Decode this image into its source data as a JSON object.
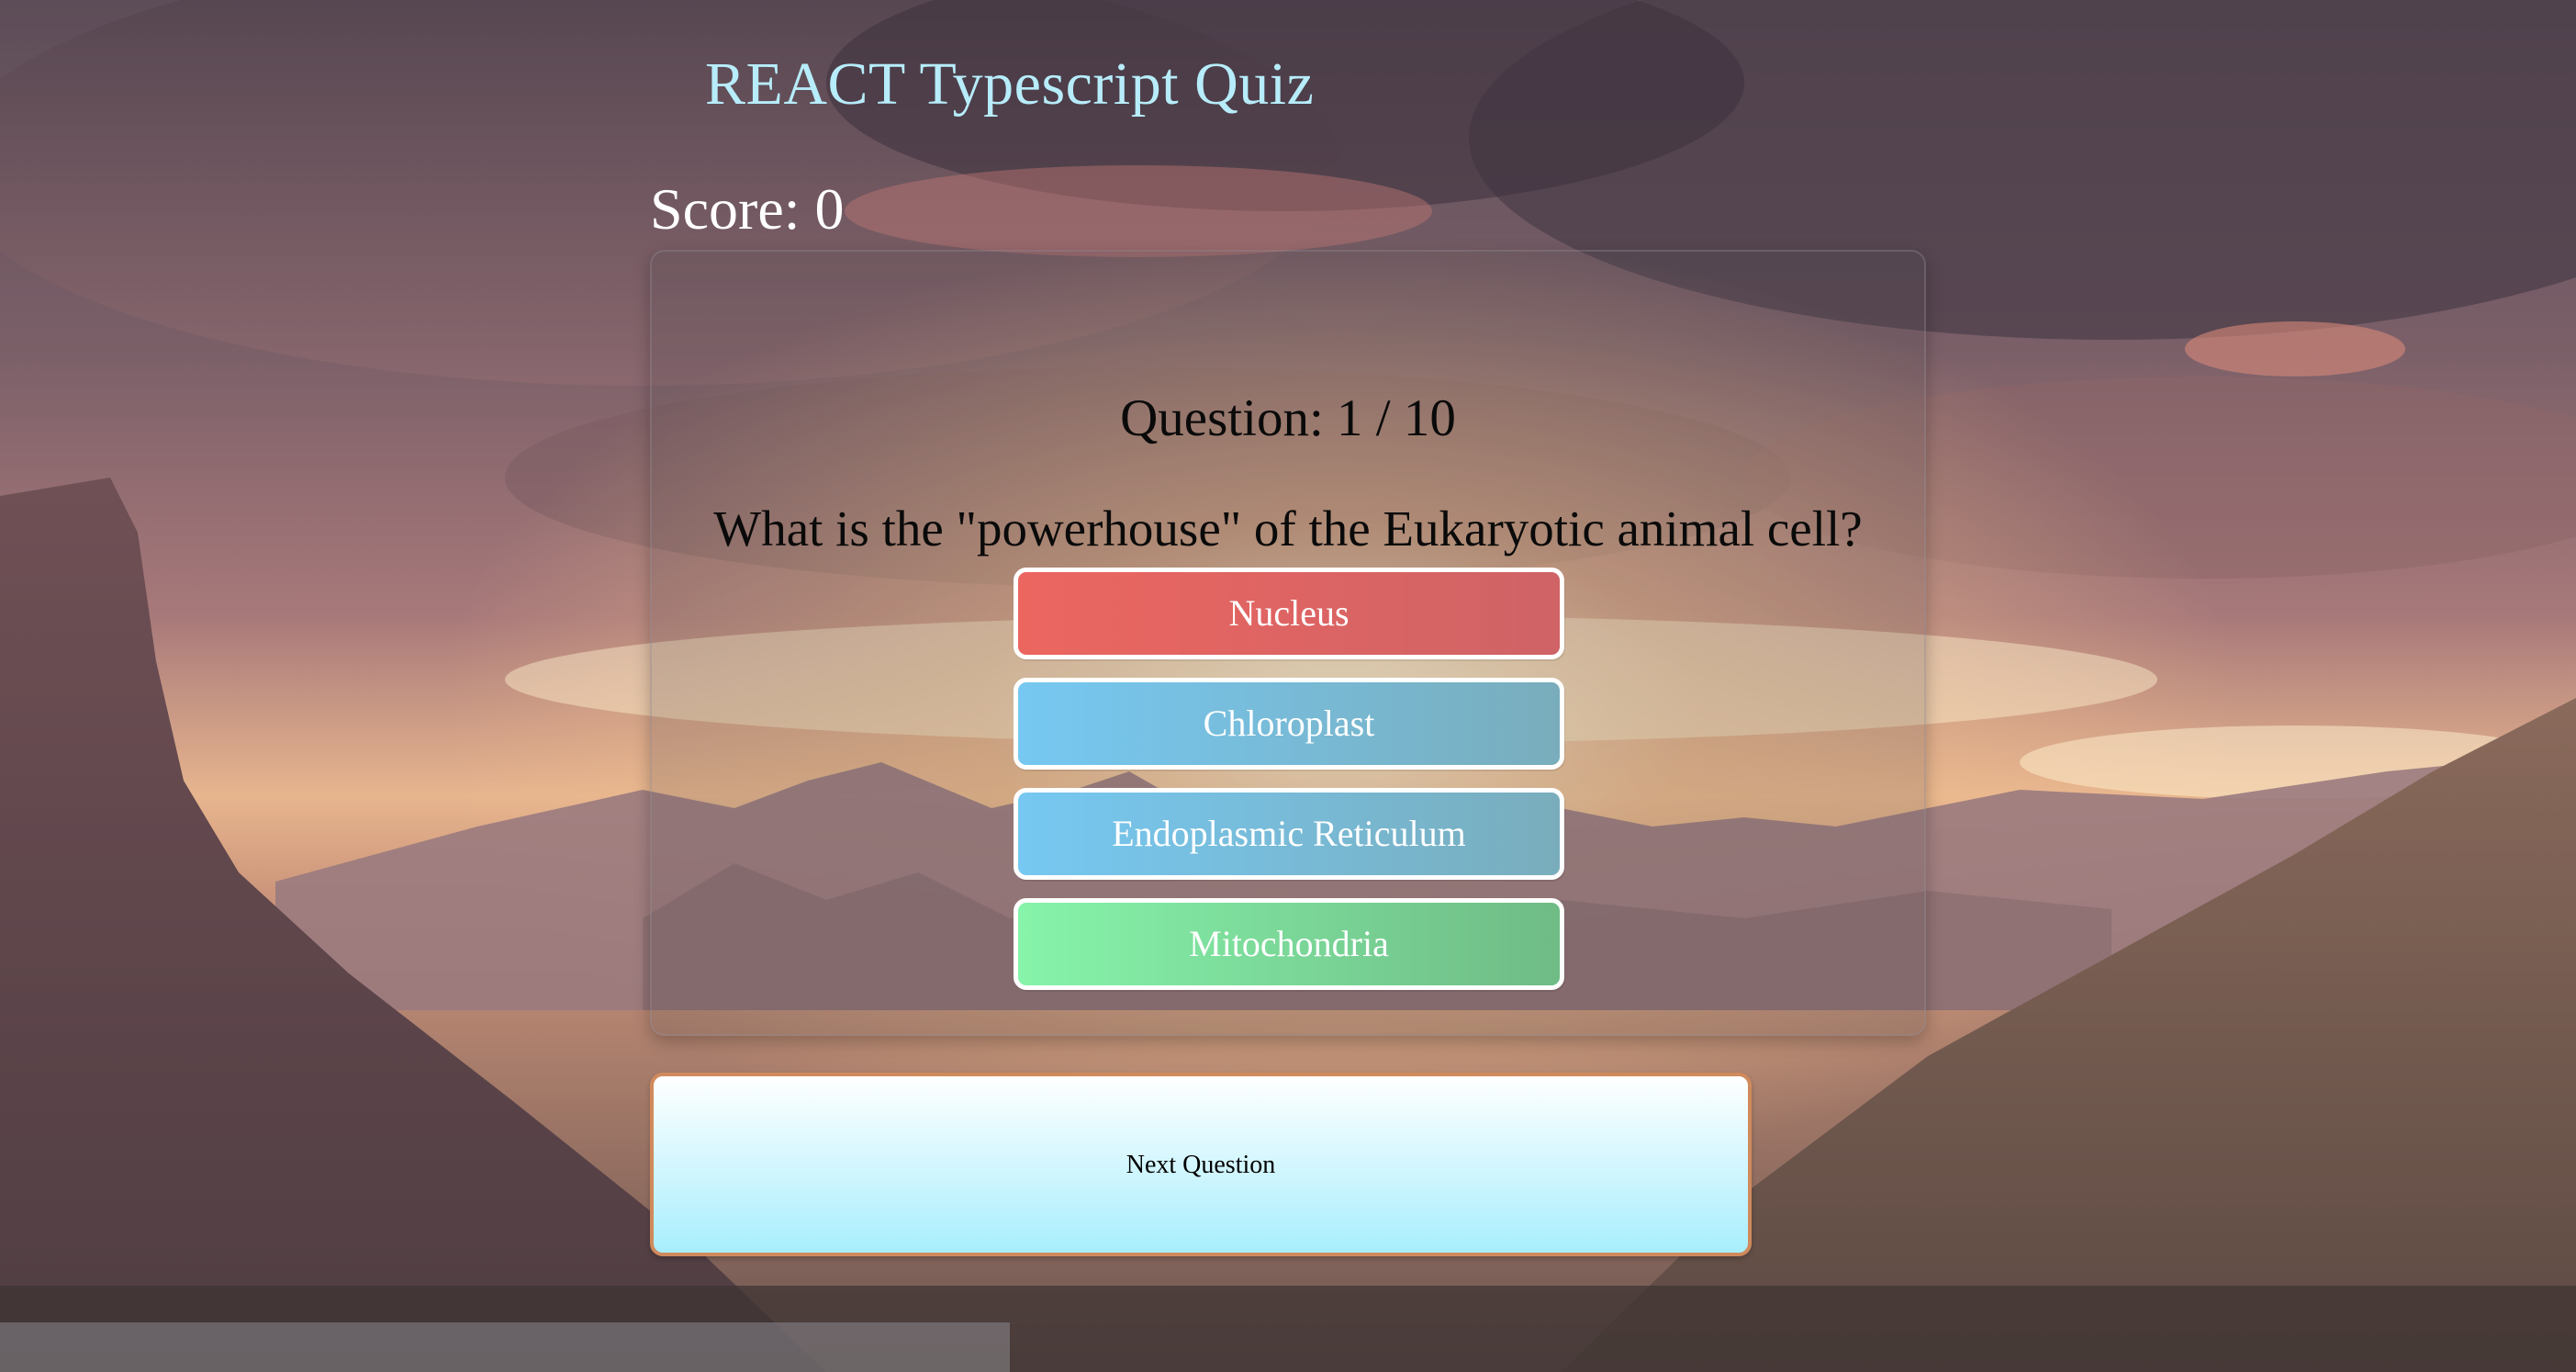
{
  "app": {
    "title": "REACT Typescript Quiz",
    "score_text": "Score: 0"
  },
  "quiz": {
    "question_number_text": "Question: 1 / 10",
    "question_text": "What is the \"powerhouse\" of the Eukaryotic animal cell?",
    "answers": [
      {
        "label": "Nucleus",
        "state": "incorrect",
        "color": "#ec6660"
      },
      {
        "label": "Chloroplast",
        "state": "neutral",
        "color": "#76c8f2"
      },
      {
        "label": "Endoplasmic Reticulum",
        "state": "neutral",
        "color": "#76c8f2"
      },
      {
        "label": "Mitochondria",
        "state": "correct",
        "color": "#86f4aa"
      }
    ]
  },
  "controls": {
    "next_label": "Next Question"
  },
  "colors": {
    "title": "#b7ecfa",
    "incorrect": "#ec6660",
    "neutral": "#76c8f2",
    "correct": "#86f4aa",
    "next_border": "#d08a5c",
    "next_gradient_bottom": "#a8eefd"
  }
}
